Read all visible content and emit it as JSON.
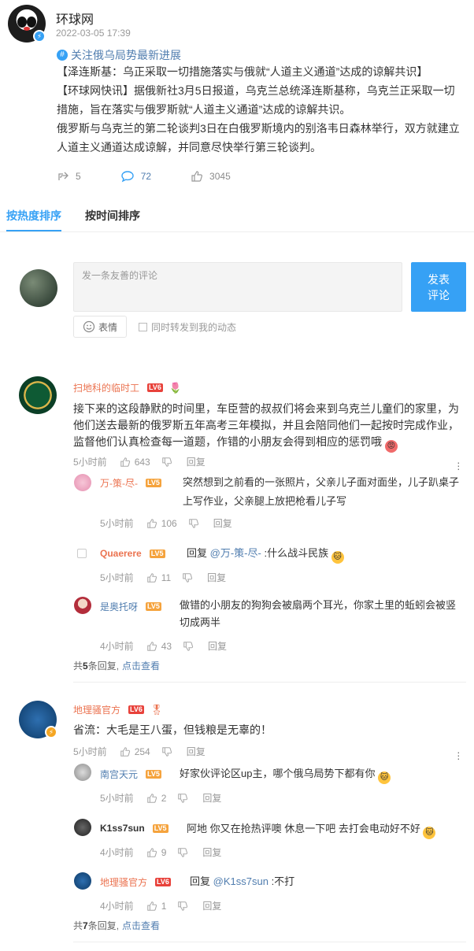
{
  "post": {
    "author": "环球网",
    "timestamp": "2022-03-05 17:39",
    "topic": "关注俄乌局势最新进展",
    "paragraphs": [
      "【泽连斯基：乌正采取一切措施落实与俄就“人道主义通道”达成的谅解共识】",
      "【环球网快讯】据俄新社3月5日报道，乌克兰总统泽连斯基称，乌克兰正采取一切措施，旨在落实与俄罗斯就“人道主义通道”达成的谅解共识。",
      "俄罗斯与乌克兰的第二轮谈判3日在白俄罗斯境内的别洛韦日森林举行，双方就建立人道主义通道达成谅解，并同意尽快举行第三轮谈判。"
    ],
    "reposts": "5",
    "comments": "72",
    "likes": "3045"
  },
  "tabs": {
    "hot": "按热度排序",
    "time": "按时间排序"
  },
  "composer": {
    "placeholder": "发一条友善的评论",
    "submit_line1": "发表",
    "submit_line2": "评论",
    "emoji_label": "表情",
    "repost_label": "同时转发到我的动态"
  },
  "colors": {
    "accent": "#36a1f5",
    "username": "#eb7350",
    "link": "#507daf"
  },
  "comments": [
    {
      "user": "扫地科的临时工",
      "level": "LV6",
      "text": "接下来的这段静默的时间里，车臣营的叔叔们将会来到乌克兰儿童们的家里，为他们送去最新的俄罗斯五年高考三年模拟，并且会陪同他们一起按时完成作业，监督他们认真检查每一道题，作错的小朋友会得到相应的惩罚哦",
      "time": "5小时前",
      "likes": "643",
      "reply_label": "回复",
      "replies": [
        {
          "user": "万-策-尽-",
          "level": "LV5",
          "text": "突然想到之前看的一张照片，父亲儿子面对面坐，儿子趴桌子上写作业，父亲腿上放把枪看儿子写",
          "time": "5小时前",
          "likes": "106",
          "reply_label": "回复"
        },
        {
          "user": "Quaerere",
          "level": "LV5",
          "prefix": "回复",
          "mention": "@万-策-尽-",
          "text": ":什么战斗民族",
          "time": "5小时前",
          "likes": "11",
          "reply_label": "回复"
        },
        {
          "user": "是奥托呀",
          "level": "LV5",
          "text": "做错的小朋友的狗狗会被扇两个耳光，你家土里的蚯蚓会被竖切成两半",
          "time": "4小时前",
          "likes": "43",
          "reply_label": "回复"
        }
      ],
      "summary_prefix": "共",
      "summary_count": "5",
      "summary_suffix": "条回复,",
      "summary_link": "点击查看"
    },
    {
      "user": "地理骚官方",
      "level": "LV6",
      "text": "省流：大毛是王八蛋，但钱粮是无辜的！",
      "time": "5小时前",
      "likes": "254",
      "reply_label": "回复",
      "replies": [
        {
          "user": "南宫天元",
          "level": "LV5",
          "text": "好家伙评论区up主，哪个俄乌局势下都有你",
          "time": "5小时前",
          "likes": "2",
          "reply_label": "回复"
        },
        {
          "user": "K1ss7sun",
          "level": "LV5",
          "text": "阿地 你又在抢热评噢 休息一下吧 去打会电动好不好",
          "time": "4小时前",
          "likes": "9",
          "reply_label": "回复"
        },
        {
          "user": "地理骚官方",
          "level": "LV6",
          "prefix": "回复",
          "mention": "@K1ss7sun",
          "text": ":不打",
          "time": "4小时前",
          "likes": "1",
          "reply_label": "回复"
        }
      ],
      "summary_prefix": "共",
      "summary_count": "7",
      "summary_suffix": "条回复,",
      "summary_link": "点击查看"
    }
  ]
}
